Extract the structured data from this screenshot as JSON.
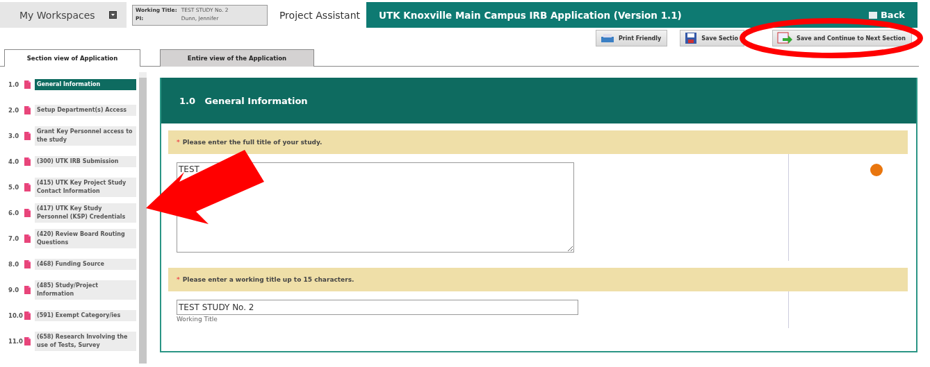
{
  "top_bar": {
    "workspaces": "My Workspaces",
    "study_info": {
      "working_title_label": "Working Title:",
      "working_title": "TEST STUDY No. 2",
      "pi_label": "PI:",
      "pi": "Dunn, Jennifer"
    },
    "assistant": "Project Assistant",
    "title": "UTK Knoxville Main Campus IRB Application (Version 1.1)",
    "back": "Back"
  },
  "toolbar": [
    {
      "kind": "print",
      "label": "Print Friendly"
    },
    {
      "kind": "save",
      "label": "Save Sectio"
    },
    {
      "kind": "continue",
      "label": "Save and Continue to Next Section"
    }
  ],
  "tabs": [
    {
      "label": "Section view of Application",
      "selected": true
    },
    {
      "label": "Entire view of the Application",
      "selected": false
    }
  ],
  "sidebar": {
    "items": [
      {
        "number": "1.0",
        "label": "General Information",
        "selected": true
      },
      {
        "number": "2.0",
        "label": "Setup Department(s) Access",
        "selected": false
      },
      {
        "number": "3.0",
        "label": "Grant Key Personnel access to the study",
        "selected": false
      },
      {
        "number": "4.0",
        "label": "(300) UTK IRB Submission",
        "selected": false
      },
      {
        "number": "5.0",
        "label": "(415) UTK Key Project Study Contact Information",
        "selected": false
      },
      {
        "number": "6.0",
        "label": "(417) UTK Key Study Personnel (KSP) Credentials",
        "selected": false
      },
      {
        "number": "7.0",
        "label": "(420) Review Board Routing Questions",
        "selected": false
      },
      {
        "number": "8.0",
        "label": "(468) Funding Source",
        "selected": false
      },
      {
        "number": "9.0",
        "label": "(485) Study/Project Information",
        "selected": false
      },
      {
        "number": "10.0",
        "label": "(591) Exempt Category/ies",
        "selected": false
      },
      {
        "number": "11.0",
        "label": "(658) Research Involving the use of Tests, Survey",
        "selected": false
      }
    ]
  },
  "section": {
    "number": "1.0",
    "title": "General Information",
    "questions": [
      {
        "kind": "textarea",
        "required_mark": "*",
        "prompt": "Please enter the full title of your study.",
        "value": "TEST",
        "help": true
      },
      {
        "kind": "text",
        "required_mark": "*",
        "prompt": "Please enter a working title up to 15 characters.",
        "value": "TEST STUDY No. 2",
        "caption": "Working Title"
      }
    ]
  }
}
